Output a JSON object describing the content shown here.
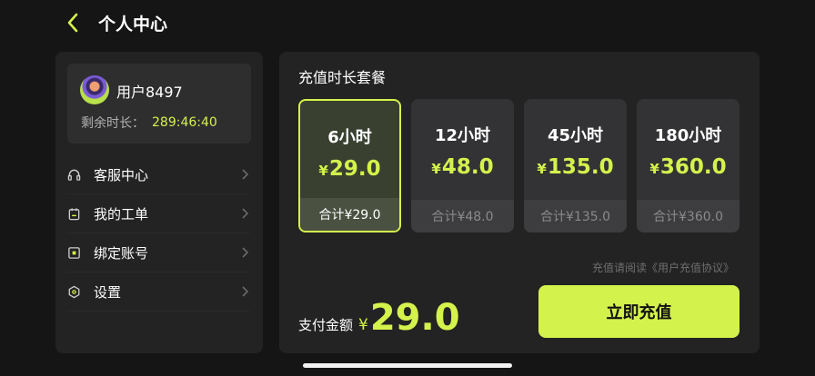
{
  "header": {
    "title": "个人中心",
    "back_icon": "chevron-left-icon"
  },
  "user": {
    "name": "用户8497",
    "remaining_label": "剩余时长：",
    "remaining_value": "289:46:40"
  },
  "menu": [
    {
      "label": "客服中心",
      "icon": "headset-icon"
    },
    {
      "label": "我的工单",
      "icon": "clipboard-icon"
    },
    {
      "label": "绑定账号",
      "icon": "link-account-icon"
    },
    {
      "label": "设置",
      "icon": "settings-hexagon-icon"
    }
  ],
  "packages": {
    "title": "充值时长套餐",
    "items": [
      {
        "hours": "6小时",
        "price": "29.0",
        "total": "合计¥29.0",
        "selected": true
      },
      {
        "hours": "12小时",
        "price": "48.0",
        "total": "合计¥48.0",
        "selected": false
      },
      {
        "hours": "45小时",
        "price": "135.0",
        "total": "合计¥135.0",
        "selected": false
      },
      {
        "hours": "180小时",
        "price": "360.0",
        "total": "合计¥360.0",
        "selected": false
      }
    ],
    "currency": "¥"
  },
  "agreement": "充值请阅读《用户充值协议》",
  "payment": {
    "label": "支付金额",
    "currency": "¥",
    "amount": "29.0"
  },
  "recharge_button": "立即充值",
  "colors": {
    "accent": "#d4f24c",
    "background": "#151515",
    "panel": "#232323"
  }
}
